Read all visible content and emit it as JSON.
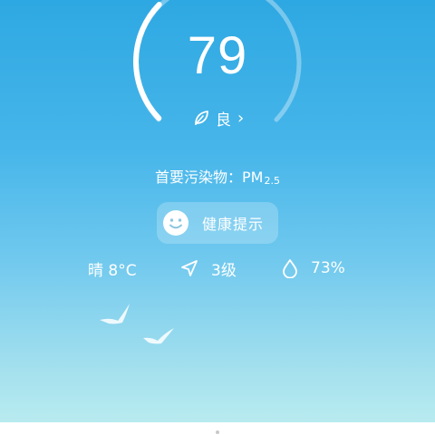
{
  "aqi": {
    "value": "79",
    "level": "良",
    "level_chevron": "›",
    "gauge_fraction": 0.33
  },
  "pollutant": {
    "prefix": "首要污染物：",
    "name": "PM",
    "subscript": "2.5"
  },
  "health_button": {
    "label": "健康提示",
    "icon": "smiley-face-icon"
  },
  "weather": {
    "condition_temp": "晴 8°C",
    "wind": "3级",
    "wind_icon": "navigation-arrow-icon",
    "humidity": "73%",
    "humidity_icon": "water-drop-icon"
  },
  "colors": {
    "sky_top": "#2ea8e2",
    "sky_bottom": "#bdeef0",
    "gauge_track": "rgba(255,255,255,0.35)",
    "gauge_fill": "#ffffff"
  }
}
